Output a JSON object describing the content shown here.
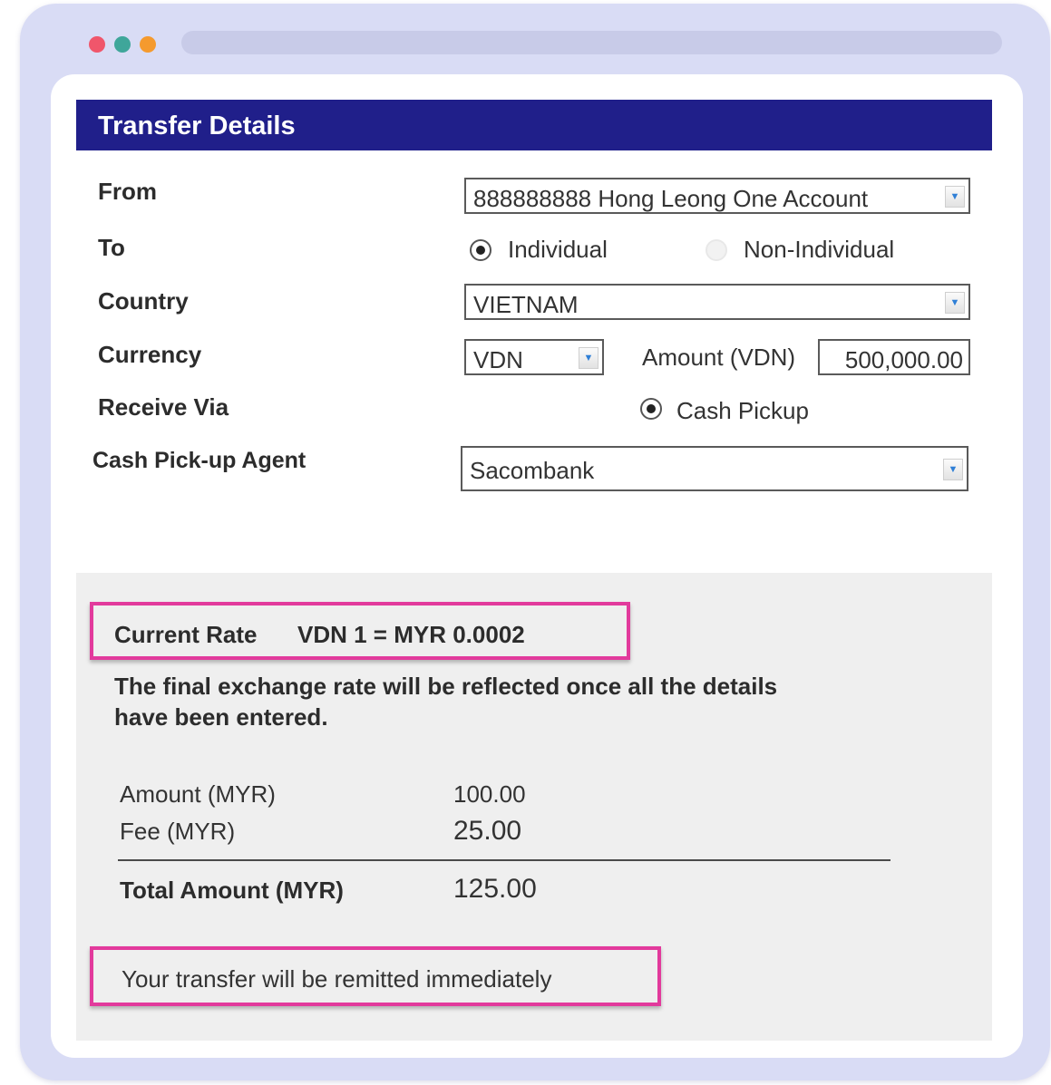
{
  "window": {
    "dots": [
      {
        "name": "red-dot",
        "color": "#f0566b"
      },
      {
        "name": "teal-dot",
        "color": "#3fa69a"
      },
      {
        "name": "orange-dot",
        "color": "#f59a2e"
      }
    ]
  },
  "header": {
    "title": "Transfer Details",
    "color": "#201f8a"
  },
  "form": {
    "from_label": "From",
    "from_value": "888888888 Hong Leong One Account",
    "to_label": "To",
    "to_options": [
      "Individual",
      "Non-Individual"
    ],
    "to_selected": "Individual",
    "country_label": "Country",
    "country_value": "VIETNAM",
    "currency_label": "Currency",
    "currency_value": "VDN",
    "amount_label": "Amount (VDN)",
    "amount_value": "500,000.00",
    "receive_label": "Receive Via",
    "receive_option": "Cash Pickup",
    "agent_label": "Cash Pick-up Agent",
    "agent_value": "Sacombank"
  },
  "summary": {
    "rate_label": "Current Rate",
    "rate_value": "VDN 1 = MYR 0.0002",
    "rate_note": "The final exchange rate will be reflected once all the details have been entered.",
    "amount_label": "Amount (MYR)",
    "amount_value": "100.00",
    "fee_label": "Fee (MYR)",
    "fee_value": "25.00",
    "total_label": "Total Amount (MYR)",
    "total_value": "125.00",
    "remit_note": "Your transfer will be remitted immediately",
    "highlight_color": "#e23a9c"
  }
}
